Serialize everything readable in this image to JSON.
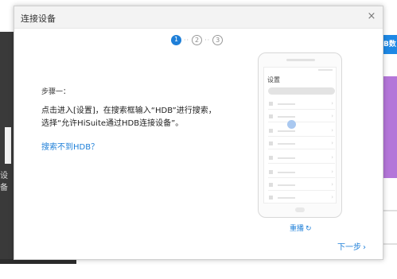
{
  "background": {
    "left_label": "设备",
    "right_tab_text": "B数"
  },
  "dialog": {
    "title": "连接设备",
    "close_icon": "×",
    "steps": [
      {
        "label": "1",
        "state": "active"
      },
      {
        "label": "2",
        "state": "inactive"
      },
      {
        "label": "3",
        "state": "inactive"
      }
    ],
    "step_label": "步骤一：",
    "instruction": "点击进入[设置]，在搜索框输入“HDB”进行搜索，选择“允许HiSuite通过HDB连接设备”。",
    "help_link": "搜索不到HDB？",
    "phone": {
      "screen_title": "设置"
    },
    "replay_label": "重播",
    "replay_icon": "↻",
    "next_label": "下一步",
    "next_icon": "›"
  },
  "colors": {
    "accent": "#1e7fd8",
    "purple_banner": "#b476d9"
  }
}
